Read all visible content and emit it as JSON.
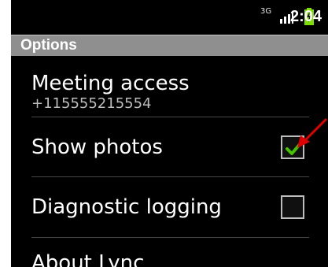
{
  "status_bar": {
    "time": "2:04",
    "network_icon_label": "3G",
    "icons": [
      "network-3g-icon",
      "signal-bars-icon",
      "battery-icon"
    ],
    "colors": {
      "battery": "#7ee000",
      "signal": "#ffffff"
    }
  },
  "title_bar": {
    "title": "Options"
  },
  "options": [
    {
      "primary": "Meeting access",
      "secondary": "+115555215554"
    },
    {
      "primary": "Show photos",
      "checked": true
    },
    {
      "primary": "Diagnostic logging",
      "checked": false
    },
    {
      "primary": "About Lync"
    }
  ],
  "annotation": {
    "type": "arrow",
    "color": "#e00000",
    "points_to": "Show photos checkbox"
  }
}
